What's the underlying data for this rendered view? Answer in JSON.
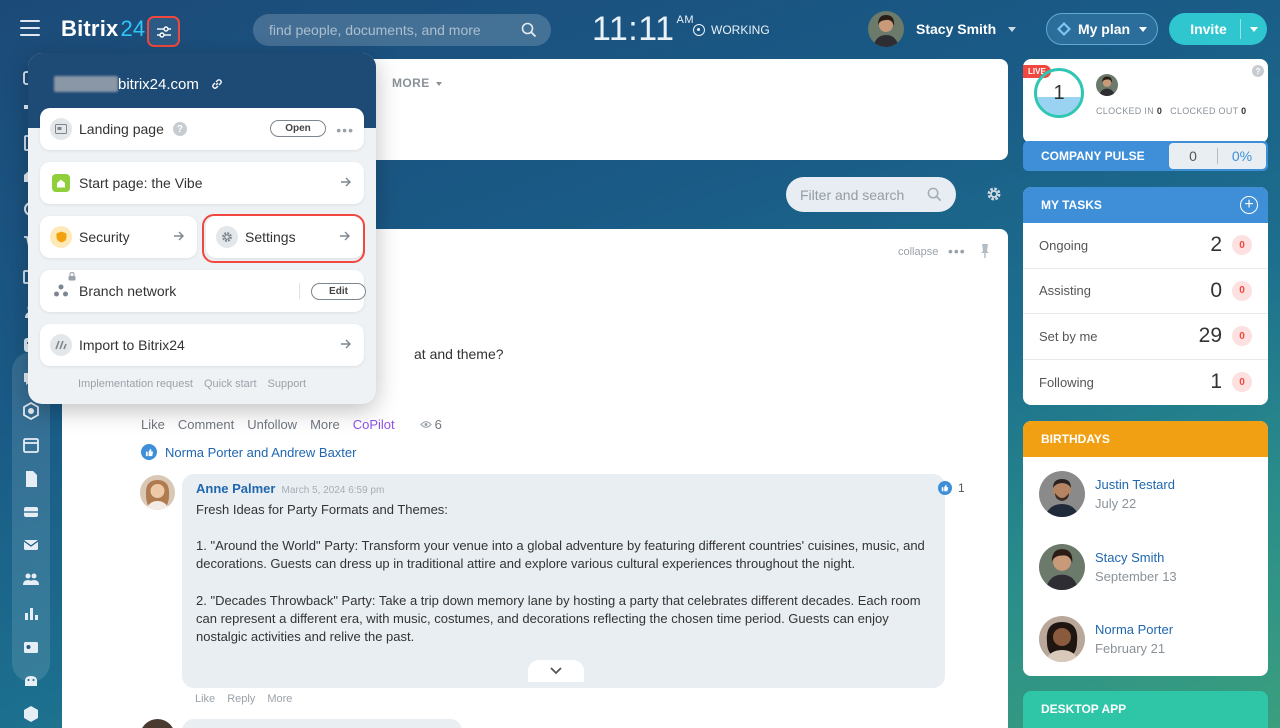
{
  "header": {
    "logo_name": "Bitrix",
    "logo_number": "24",
    "search_placeholder": "find people, documents, and more",
    "clock_time": "11:11",
    "clock_ampm": "AM",
    "work_status": "WORKING",
    "user_name": "Stacy Smith",
    "plan_label": "My plan",
    "invite_label": "Invite"
  },
  "popup": {
    "portal_name": "bitrix24.com",
    "items": {
      "landing": {
        "label": "Landing page",
        "button": "Open"
      },
      "start_page": {
        "label": "Start page: the Vibe"
      },
      "security": {
        "label": "Security"
      },
      "settings": {
        "label": "Settings"
      },
      "branch": {
        "label": "Branch network",
        "button": "Edit"
      },
      "import": {
        "label": "Import to Bitrix24"
      }
    },
    "help_mark": "?",
    "footer": [
      "Implementation request",
      "Quick start",
      "Support"
    ]
  },
  "feed": {
    "more_tab": "MORE",
    "filter_placeholder": "Filter and search",
    "collapse": "collapse",
    "post_text_fragment": "at and theme?",
    "actions": [
      "Like",
      "Comment",
      "Unfollow",
      "More",
      "CoPilot"
    ],
    "view_count": "6",
    "likes_text": "Norma Porter and Andrew Baxter",
    "comment": {
      "author": "Anne Palmer",
      "date": "March 5, 2024 6:59 pm",
      "paragraphs": [
        "Fresh Ideas for Party Formats and Themes:",
        "1. \"Around the World\" Party: Transform your venue into a global adventure by featuring different countries' cuisines, music, and decorations. Guests can dress up in traditional attire and explore various cultural experiences throughout the night.",
        "2. \"Decades Throwback\" Party: Take a trip down memory lane by hosting a party that celebrates different decades. Each room can represent a different era, with music, costumes, and decorations reflecting the chosen time period. Guests can enjoy nostalgic activities and relive the past."
      ],
      "like_count": "1",
      "actions": [
        "Like",
        "Reply",
        "More"
      ]
    }
  },
  "timeman": {
    "live": "LIVE",
    "count": "1",
    "clocked_in_label": "CLOCKED IN",
    "clocked_in_value": "0",
    "clocked_out_label": "CLOCKED OUT",
    "clocked_out_value": "0",
    "help_mark": "?"
  },
  "pulse": {
    "title": "COMPANY PULSE",
    "value": "0",
    "percent": "0%"
  },
  "tasks": {
    "title": "MY TASKS",
    "add": "+",
    "rows": [
      {
        "label": "Ongoing",
        "value": "2",
        "badge": "0"
      },
      {
        "label": "Assisting",
        "value": "0",
        "badge": "0"
      },
      {
        "label": "Set by me",
        "value": "29",
        "badge": "0"
      },
      {
        "label": "Following",
        "value": "1",
        "badge": "0"
      }
    ]
  },
  "birthdays": {
    "title": "BIRTHDAYS",
    "people": [
      {
        "name": "Justin Testard",
        "date": "July 22"
      },
      {
        "name": "Stacy Smith",
        "date": "September 13"
      },
      {
        "name": "Norma Porter",
        "date": "February 21"
      }
    ]
  },
  "desktop_app": {
    "title": "DESKTOP APP"
  },
  "colors": {
    "accent_blue": "#3e8fd8",
    "highlight_red": "#f0483e",
    "birthdays_orange": "#f0a012",
    "desktop_teal": "#2fc6a8",
    "invite_teal": "#2fc6d0",
    "copilot_purple": "#8e52ec"
  }
}
